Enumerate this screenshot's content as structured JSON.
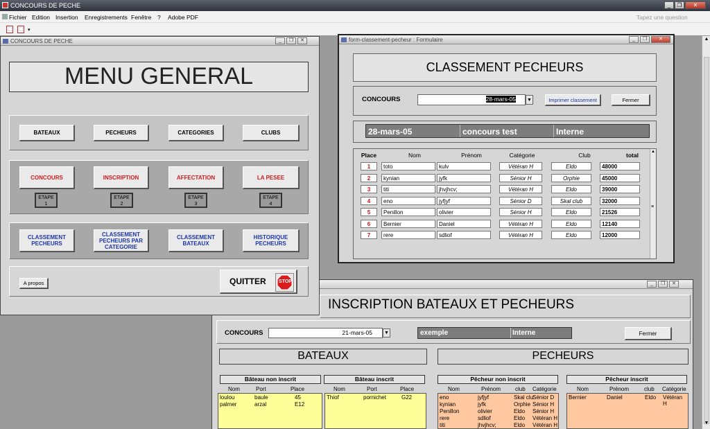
{
  "app": {
    "title": "CONCOURS DE PECHE",
    "menus": [
      "Fichier",
      "Edition",
      "Insertion",
      "Enregistrements",
      "Fenêtre",
      "?",
      "Adobe PDF"
    ],
    "question_placeholder": "Tapez une question"
  },
  "menu_win": {
    "title": "CONCOURS DE PECHE",
    "heading": "MENU GENERAL",
    "row1": [
      "BATEAUX",
      "PECHEURS",
      "CATEGORIES",
      "CLUBS"
    ],
    "row2": [
      "CONCOURS",
      "INSCRIPTION",
      "AFFECTATION",
      "LA PESEE"
    ],
    "etapes": [
      {
        "l": "ETAPE",
        "n": "1"
      },
      {
        "l": "ETAPE",
        "n": "2"
      },
      {
        "l": "ETAPE",
        "n": "3"
      },
      {
        "l": "ETAPE",
        "n": "4"
      }
    ],
    "row3": [
      "CLASSEMENT PECHEURS",
      "CLASSEMENT PECHEURS PAR CATEGORIE",
      "CLASSEMENT BATEAUX",
      "HISTORIQUE PECHEURS"
    ],
    "apropos": "A propos",
    "quit": "QUITTER",
    "stop": "STOP"
  },
  "classement": {
    "title": "form-classement-pecheur : Formulaire",
    "heading": "CLASSEMENT PECHEURS",
    "concours_label": "CONCOURS",
    "concours_value": "28-mars-05",
    "print_btn": "Imprimer classement",
    "close_btn": "Fermer",
    "info": [
      "28-mars-05",
      "concours test",
      "Interne"
    ],
    "columns": [
      "Place",
      "Nom",
      "Prénom",
      "Catégorie",
      "Club",
      "total"
    ],
    "rows": [
      [
        "1",
        "toto",
        "kulv",
        "Vétéran H",
        "Eldo",
        "48000"
      ],
      [
        "2",
        "kynian",
        "jyfk",
        "Sénior H",
        "Orphie",
        "45000"
      ],
      [
        "3",
        "titi",
        "jhvjhcv;",
        "Vétéran H",
        "Eldo",
        "39000"
      ],
      [
        "4",
        "eno",
        "jyfjyf",
        "Sénior D",
        "Skal club",
        "32000"
      ],
      [
        "5",
        "Penillon",
        "olivier",
        "Sénior H",
        "Eldo",
        "21526"
      ],
      [
        "6",
        "Bernier",
        "Daniel",
        "Vétéran H",
        "Eldo",
        "12140"
      ],
      [
        "7",
        "rere",
        "sdliof",
        "Vétéran H",
        "Eldo",
        "12000"
      ]
    ]
  },
  "inscription": {
    "heading": "INSCRIPTION BATEAUX ET PECHEURS",
    "concours_label": "CONCOURS",
    "concours_value": "21-mars-05",
    "info": [
      "exemple",
      "Interne"
    ],
    "close_btn": "Fermer",
    "bateaux_title": "BATEAUX",
    "pecheurs_title": "PECHEURS",
    "bnon": {
      "title": "Bâteau non  inscrit",
      "cols": [
        "Nom",
        "Port",
        "Place"
      ],
      "rows": [
        [
          "loulou",
          "baule",
          "45"
        ],
        [
          "palmer",
          "arzal",
          "E12"
        ]
      ]
    },
    "bins": {
      "title": "Bâteau inscrit",
      "cols": [
        "Nom",
        "Port",
        "Place"
      ],
      "rows": [
        [
          "Thiof",
          "pornichet",
          "G22"
        ]
      ]
    },
    "pnon": {
      "title": "Pêcheur non inscrit",
      "cols": [
        "Nom",
        "Prénom",
        "club",
        "Catégorie"
      ],
      "rows": [
        [
          "eno",
          "jyfjyf",
          "Skal clu",
          "Sénior D"
        ],
        [
          "kynian",
          "jyfk",
          "Orphie",
          "Sénior H"
        ],
        [
          "Penillon",
          "olivier",
          "Eldo",
          "Sénior H"
        ],
        [
          "rere",
          "sdliof",
          "Eldo",
          "Vétéran H"
        ],
        [
          "titi",
          "jhvjhcv;",
          "Eldo",
          "Vétéran H"
        ]
      ]
    },
    "pins": {
      "title": "Pêcheur inscrit",
      "cols": [
        "Nom",
        "Prénom",
        "club",
        "Catégorie"
      ],
      "rows": [
        [
          "Bernier",
          "Daniel",
          "Eldo",
          "Vétéran H"
        ]
      ]
    }
  },
  "colors": {
    "red_text": "#d21b1b",
    "blue_text": "#1c36a8",
    "yellow": "#ffff99",
    "peach": "#ffc8a0",
    "dark_info": "#7d7d7d"
  }
}
